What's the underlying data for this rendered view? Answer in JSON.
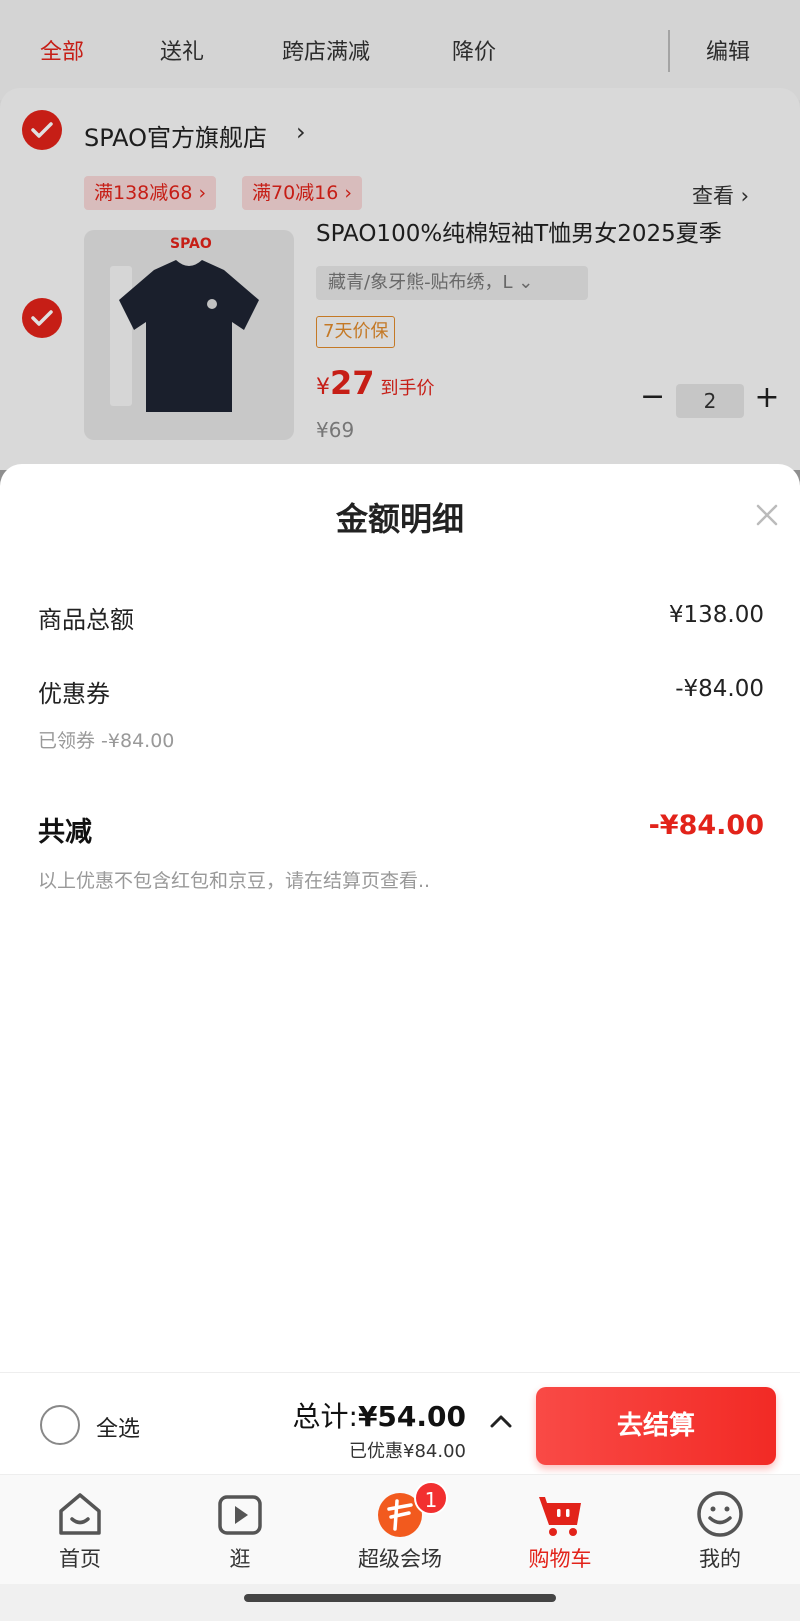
{
  "tabs": [
    {
      "label": "全部",
      "active": true
    },
    {
      "label": "送礼",
      "active": false
    },
    {
      "label": "跨店满减",
      "active": false
    },
    {
      "label": "降价",
      "active": false
    }
  ],
  "edit_label": "编辑",
  "store": {
    "name": "SPAO官方旗舰店",
    "promos": [
      "满138减68 ›",
      "满70减16 ›"
    ],
    "view_more": "查看 ›",
    "product": {
      "brand": "SPAO",
      "title": "SPAO100%纯棉短袖T恤男女2025夏季",
      "variant": "藏青/象牙熊-贴布绣，L ⌄",
      "badge": "7天价保",
      "price_currency": "¥",
      "price": "27",
      "price_tip": "到手价",
      "original_price": "¥69",
      "quantity": "2"
    }
  },
  "sheet": {
    "title": "金额明细",
    "rows": [
      {
        "label": "商品总额",
        "value": "¥138.00"
      },
      {
        "label": "优惠券",
        "value": "-¥84.00",
        "sub": "已领券 -¥84.00"
      }
    ],
    "total_label": "共减",
    "total_value": "-¥84.00",
    "note": "以上优惠不包含红包和京豆，请在结算页查看.."
  },
  "bottom_bar": {
    "select_all": "全选",
    "sum_prefix": "总计:",
    "sum_value": "¥54.00",
    "saved": "已优惠¥84.00",
    "checkout": "去结算"
  },
  "tabbar": [
    {
      "label": "首页",
      "icon": "home-icon"
    },
    {
      "label": "逛",
      "icon": "video-play-icon"
    },
    {
      "label": "超级会场",
      "icon": "super-venue-icon",
      "badge": "1"
    },
    {
      "label": "购物车",
      "icon": "cart-icon",
      "active": true
    },
    {
      "label": "我的",
      "icon": "profile-smile-icon"
    }
  ],
  "colors": {
    "accent": "#e2231a",
    "badge_orange": "#e08a2c"
  }
}
